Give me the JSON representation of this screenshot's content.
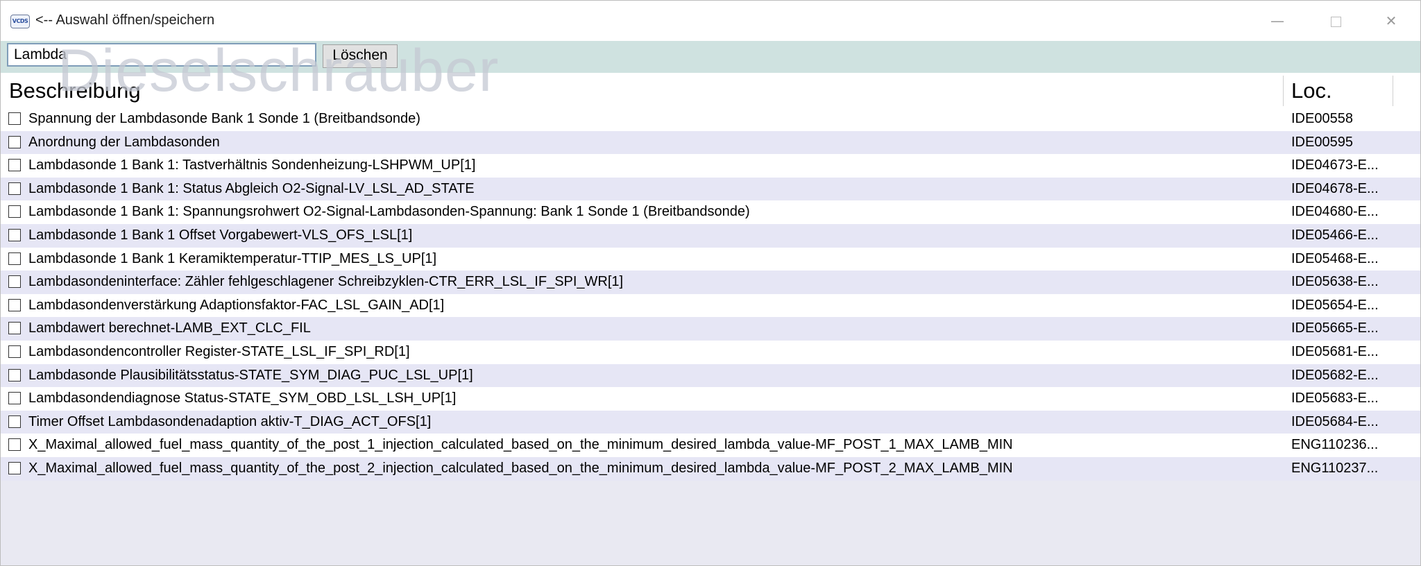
{
  "window": {
    "title": "<-- Auswahl öffnen/speichern",
    "icon_text": "VCDS",
    "minimize_glyph": "—",
    "close_glyph": "✕"
  },
  "toolbar": {
    "search_value": "Lambda",
    "clear_label": "Löschen",
    "watermark": "Dieselschrauber"
  },
  "columns": {
    "description": "Beschreibung",
    "location": "Loc."
  },
  "rows": [
    {
      "description": "Spannung der Lambdasonde Bank 1 Sonde 1 (Breitbandsonde)",
      "loc": "IDE00558"
    },
    {
      "description": "Anordnung der Lambdasonden",
      "loc": "IDE00595"
    },
    {
      "description": "Lambdasonde 1 Bank 1: Tastverhältnis Sondenheizung-LSHPWM_UP[1]",
      "loc": "IDE04673-E..."
    },
    {
      "description": "Lambdasonde 1 Bank 1: Status Abgleich O2-Signal-LV_LSL_AD_STATE",
      "loc": "IDE04678-E..."
    },
    {
      "description": "Lambdasonde 1 Bank 1: Spannungsrohwert O2-Signal-Lambdasonden-Spannung: Bank 1 Sonde 1 (Breitbandsonde)",
      "loc": "IDE04680-E..."
    },
    {
      "description": "Lambdasonde 1 Bank 1 Offset Vorgabewert-VLS_OFS_LSL[1]",
      "loc": "IDE05466-E..."
    },
    {
      "description": "Lambdasonde 1 Bank 1 Keramiktemperatur-TTIP_MES_LS_UP[1]",
      "loc": "IDE05468-E..."
    },
    {
      "description": "Lambdasondeninterface: Zähler fehlgeschlagener Schreibzyklen-CTR_ERR_LSL_IF_SPI_WR[1]",
      "loc": "IDE05638-E..."
    },
    {
      "description": "Lambdasondenverstärkung Adaptionsfaktor-FAC_LSL_GAIN_AD[1]",
      "loc": "IDE05654-E..."
    },
    {
      "description": "Lambdawert berechnet-LAMB_EXT_CLC_FIL",
      "loc": "IDE05665-E..."
    },
    {
      "description": "Lambdasondencontroller Register-STATE_LSL_IF_SPI_RD[1]",
      "loc": "IDE05681-E..."
    },
    {
      "description": "Lambdasonde Plausibilitätsstatus-STATE_SYM_DIAG_PUC_LSL_UP[1]",
      "loc": "IDE05682-E..."
    },
    {
      "description": "Lambdasondendiagnose Status-STATE_SYM_OBD_LSL_LSH_UP[1]",
      "loc": "IDE05683-E..."
    },
    {
      "description": "Timer Offset Lambdasondenadaption aktiv-T_DIAG_ACT_OFS[1]",
      "loc": "IDE05684-E..."
    },
    {
      "description": "X_Maximal_allowed_fuel_mass_quantity_of_the_post_1_injection_calculated_based_on_the_minimum_desired_lambda_value-MF_POST_1_MAX_LAMB_MIN",
      "loc": "ENG110236..."
    },
    {
      "description": "X_Maximal_allowed_fuel_mass_quantity_of_the_post_2_injection_calculated_based_on_the_minimum_desired_lambda_value-MF_POST_2_MAX_LAMB_MIN",
      "loc": "ENG110237..."
    }
  ]
}
